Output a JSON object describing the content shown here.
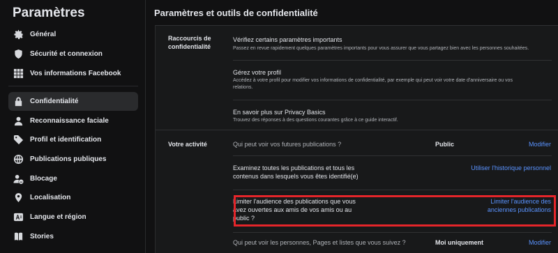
{
  "sidebar": {
    "title": "Paramètres",
    "items": [
      {
        "label": "Général",
        "icon": "gear-icon"
      },
      {
        "label": "Sécurité et connexion",
        "icon": "shield-icon"
      },
      {
        "label": "Vos informations Facebook",
        "icon": "grid-icon"
      },
      {
        "label": "Confidentialité",
        "icon": "lock-icon"
      },
      {
        "label": "Reconnaissance faciale",
        "icon": "face-user-icon"
      },
      {
        "label": "Profil et identification",
        "icon": "tag-icon"
      },
      {
        "label": "Publications publiques",
        "icon": "globe-icon"
      },
      {
        "label": "Blocage",
        "icon": "block-user-icon"
      },
      {
        "label": "Localisation",
        "icon": "location-pin-icon"
      },
      {
        "label": "Langue et région",
        "icon": "language-icon"
      },
      {
        "label": "Stories",
        "icon": "book-icon"
      }
    ]
  },
  "main": {
    "title": "Paramètres et outils de confidentialité",
    "shortcuts": {
      "label": "Raccourcis de confidentialité",
      "rows": [
        {
          "title": "Vérifiez certains paramètres importants",
          "desc": "Passez en revue rapidement quelques paramètres importants pour vous assurer que vous partagez bien avec les personnes souhaitées."
        },
        {
          "title": "Gérez votre profil",
          "desc": "Accédez à votre profil pour modifier vos informations de confidentialité, par exemple qui peut voir votre date d'anniversaire ou vos relations."
        },
        {
          "title": "En savoir plus sur Privacy Basics",
          "desc": "Trouvez des réponses à des questions courantes grâce à ce guide interactif."
        }
      ]
    },
    "activity": {
      "label": "Votre activité",
      "rows": [
        {
          "title": "Qui peut voir vos futures publications ?",
          "value": "Public",
          "link": "Modifier"
        },
        {
          "title": "Examinez toutes les publications et tous les contenus dans lesquels vous êtes identifié(e)",
          "value": "",
          "link": "Utiliser l'historique personnel"
        },
        {
          "title": "Limiter l'audience des publications que vous avez ouvertes aux amis de vos amis ou au public ?",
          "value": "",
          "link": "Limiter l'audience des anciennes publications"
        },
        {
          "title": "Qui peut voir les personnes, Pages et listes que vous suivez ?",
          "value": "Moi uniquement",
          "link": "Modifier"
        }
      ]
    }
  },
  "colors": {
    "accent_link": "#5a93ff",
    "highlight_border": "#e5252a",
    "background": "#111112",
    "card": "#18191a"
  }
}
